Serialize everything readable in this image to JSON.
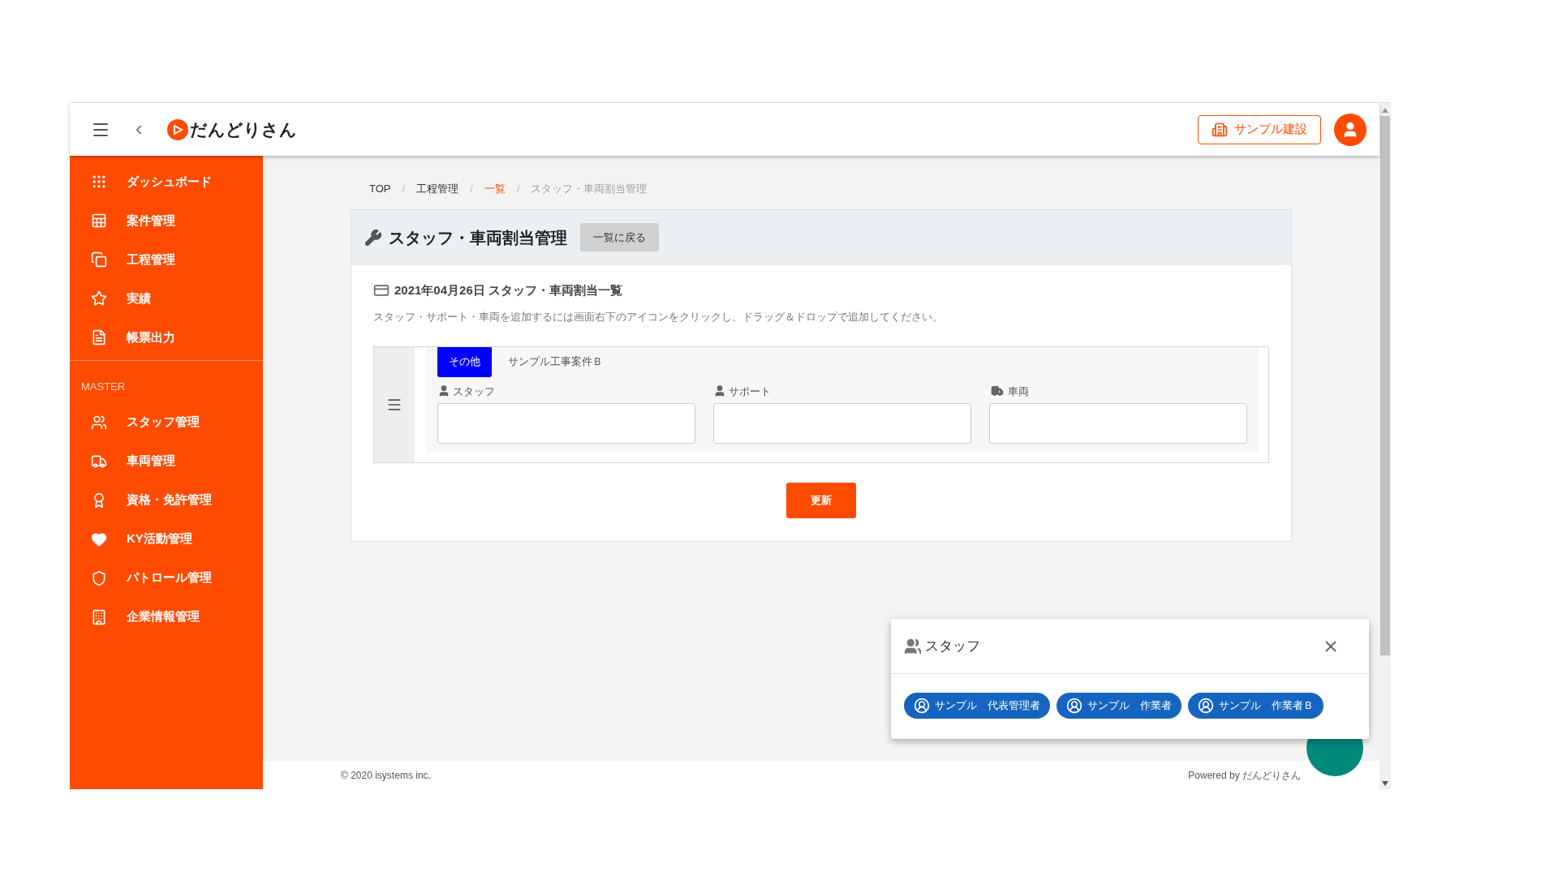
{
  "header": {
    "logo_text": "だんどりさん",
    "company_button": "サンプル建設"
  },
  "sidebar": {
    "items": [
      {
        "label": "ダッシュボード"
      },
      {
        "label": "案件管理"
      },
      {
        "label": "工程管理"
      },
      {
        "label": "実績"
      },
      {
        "label": "帳票出力"
      }
    ],
    "section_title": "MASTER",
    "master_items": [
      {
        "label": "スタッフ管理"
      },
      {
        "label": "車両管理"
      },
      {
        "label": "資格・免許管理"
      },
      {
        "label": "KY活動管理"
      },
      {
        "label": "パトロール管理"
      },
      {
        "label": "企業情報管理"
      }
    ]
  },
  "breadcrumb_separator": "/",
  "breadcrumb": [
    {
      "label": "TOP",
      "kind": "plain"
    },
    {
      "label": "工程管理",
      "kind": "plain"
    },
    {
      "label": "一覧",
      "kind": "link"
    },
    {
      "label": "スタッフ・車両割当管理",
      "kind": "current"
    }
  ],
  "card": {
    "title": "スタッフ・車両割当管理",
    "back_button": "一覧に戻る",
    "section_title": "2021年04月26日 スタッフ・車両割当一覧",
    "hint": "スタッフ・サポート・車両を追加するには画面右下のアイコンをクリックし、ドラッグ＆ドロップで追加してください。",
    "tabs": [
      {
        "label": "その他",
        "selected": true
      },
      {
        "label": "サンプル工事案件Ｂ",
        "selected": false
      }
    ],
    "columns": [
      {
        "label": "スタッフ",
        "kind": "person"
      },
      {
        "label": "サポート",
        "kind": "person"
      },
      {
        "label": "車両",
        "kind": "vehicle"
      }
    ],
    "update_button": "更新"
  },
  "popup": {
    "title": "スタッフ",
    "chips": [
      {
        "label": "サンプル　代表管理者"
      },
      {
        "label": "サンプル　作業者"
      },
      {
        "label": "サンプル　作業者Ｂ"
      }
    ]
  },
  "footer": {
    "copyright": "© 2020 isystems inc.",
    "powered_by": "Powered by だんどりさん"
  }
}
